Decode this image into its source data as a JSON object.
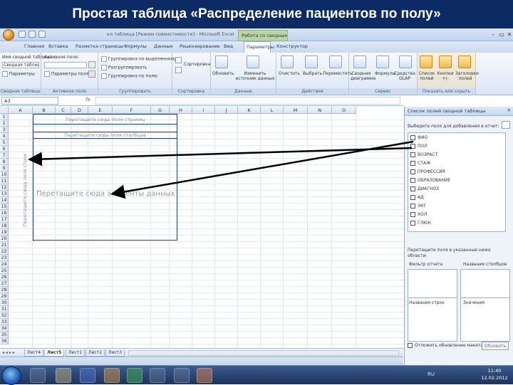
{
  "slide": {
    "title": "Простая таблица «Распределение пациентов по полу»"
  },
  "window": {
    "title": "кл таблица [Режим совместимости] - Microsoft Excel",
    "context_tab_group": "Работа со сводными таблицами",
    "controls": [
      "–",
      "▭",
      "✕"
    ]
  },
  "ribbon": {
    "tabs": [
      "Главная",
      "Вставка",
      "Разметка страницы",
      "Формулы",
      "Данные",
      "Рецензирование",
      "Вид",
      "Параметры",
      "Конструктор"
    ],
    "active_tab": "Параметры",
    "groups": {
      "pivot": {
        "label": "Сводная таблица",
        "name_label": "Имя сводной таблицы:",
        "name_value": "Сводная таблица1",
        "options_label": "Параметры"
      },
      "active_field": {
        "label": "Активное поле",
        "title": "Активное поле:",
        "field_settings": "Параметры поля"
      },
      "group": {
        "label": "Группировать",
        "items": [
          "Группировка по выделенному",
          "Разгруппировать",
          "Группировка по полю"
        ]
      },
      "sort": {
        "label": "Сортировка",
        "items": [
          "Сортировка"
        ]
      },
      "data": {
        "label": "Данные",
        "items": [
          "Обновить",
          "Изменить источник данных"
        ]
      },
      "actions": {
        "label": "Действия",
        "items": [
          "Очистить",
          "Выбрать",
          "Переместить"
        ]
      },
      "tools": {
        "label": "Сервис",
        "items": [
          "Сводная диаграмма",
          "Формулы",
          "Средства OLAP"
        ]
      },
      "show": {
        "label": "Показать или скрыть",
        "items": [
          "Список полей",
          "Кнопки +/-",
          "Заголовки полей"
        ]
      }
    }
  },
  "formula_bar": {
    "cell": "A3",
    "fx": "fx"
  },
  "sheet": {
    "columns": [
      "A",
      "B",
      "C",
      "D",
      "E",
      "F",
      "G",
      "H",
      "I",
      "J",
      "K",
      "L",
      "M",
      "N",
      "O"
    ],
    "rows": [
      "1",
      "2",
      "3",
      "4",
      "5",
      "6",
      "7",
      "8",
      "9",
      "10",
      "11",
      "12",
      "13",
      "14",
      "15",
      "16",
      "17",
      "18",
      "19",
      "20",
      "21",
      "22",
      "23",
      "24",
      "25",
      "26",
      "27",
      "28",
      "29",
      "30",
      "31",
      "32",
      "33",
      "34",
      "35",
      "36"
    ],
    "tabs": [
      "Лист4",
      "Лист5",
      "Лист1",
      "Лист2",
      "Лист3"
    ],
    "active_tab": "Лист5"
  },
  "pivot": {
    "page_drop": "Перетащите сюда поля страниц",
    "column_drop": "Перетащите сюда поля столбцов",
    "row_drop": "Перетащите сюда поля строк",
    "data_drop": "Перетащите сюда элементы данных"
  },
  "field_list": {
    "title": "Список полей сводной таблицы",
    "choose_label": "Выберите поля для добавления в отчет:",
    "fields": [
      "ФИО",
      "ПОЛ",
      "ВОЗРАСТ",
      "СТАЖ",
      "ПРОФЕССИЯ",
      "ОБРАЗОВАНИЕ",
      "ДИАГНОЗ",
      "АД",
      "ЭКГ",
      "ХОЛ",
      "ГЛЮК"
    ],
    "drag_label": "Перетащите поля в указанные ниже области:",
    "areas": {
      "report_filter": "Фильтр отчета",
      "column_labels": "Названия столбцов",
      "row_labels": "Названия строк",
      "values": "Значения"
    },
    "defer_label": "Отложить обновление макета",
    "update_button": "Обновить"
  },
  "taskbar": {
    "time": "11:40",
    "date": "12.02.2012",
    "tray": "RU"
  }
}
